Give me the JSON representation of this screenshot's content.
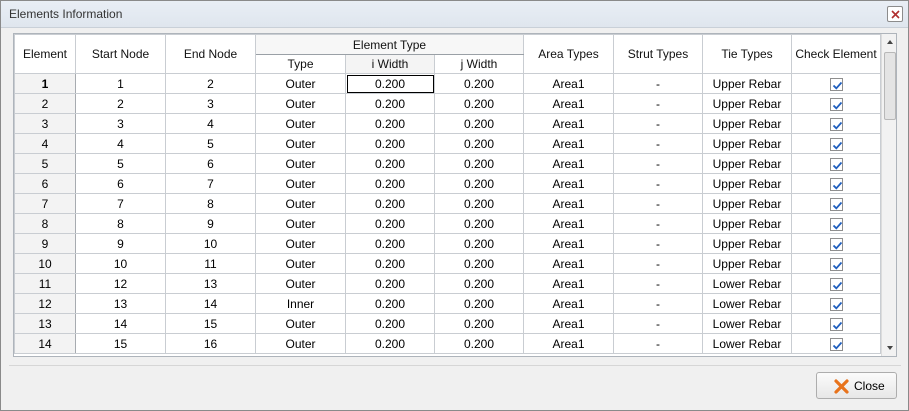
{
  "window": {
    "title": "Elements Information"
  },
  "table": {
    "headers": {
      "element": "Element",
      "start_node": "Start Node",
      "end_node": "End Node",
      "group": "Element Type",
      "type": "Type",
      "i_width": "i Width",
      "j_width": "j Width",
      "area_types": "Area Types",
      "strut_types": "Strut Types",
      "tie_types": "Tie Types",
      "check_element": "Check Element"
    },
    "rows": [
      {
        "element": "1",
        "start": "1",
        "end": "2",
        "type": "Outer",
        "iw": "0.200",
        "jw": "0.200",
        "area": "Area1",
        "strut": "-",
        "tie": "Upper Rebar",
        "checked": true
      },
      {
        "element": "2",
        "start": "2",
        "end": "3",
        "type": "Outer",
        "iw": "0.200",
        "jw": "0.200",
        "area": "Area1",
        "strut": "-",
        "tie": "Upper Rebar",
        "checked": true
      },
      {
        "element": "3",
        "start": "3",
        "end": "4",
        "type": "Outer",
        "iw": "0.200",
        "jw": "0.200",
        "area": "Area1",
        "strut": "-",
        "tie": "Upper Rebar",
        "checked": true
      },
      {
        "element": "4",
        "start": "4",
        "end": "5",
        "type": "Outer",
        "iw": "0.200",
        "jw": "0.200",
        "area": "Area1",
        "strut": "-",
        "tie": "Upper Rebar",
        "checked": true
      },
      {
        "element": "5",
        "start": "5",
        "end": "6",
        "type": "Outer",
        "iw": "0.200",
        "jw": "0.200",
        "area": "Area1",
        "strut": "-",
        "tie": "Upper Rebar",
        "checked": true
      },
      {
        "element": "6",
        "start": "6",
        "end": "7",
        "type": "Outer",
        "iw": "0.200",
        "jw": "0.200",
        "area": "Area1",
        "strut": "-",
        "tie": "Upper Rebar",
        "checked": true
      },
      {
        "element": "7",
        "start": "7",
        "end": "8",
        "type": "Outer",
        "iw": "0.200",
        "jw": "0.200",
        "area": "Area1",
        "strut": "-",
        "tie": "Upper Rebar",
        "checked": true
      },
      {
        "element": "8",
        "start": "8",
        "end": "9",
        "type": "Outer",
        "iw": "0.200",
        "jw": "0.200",
        "area": "Area1",
        "strut": "-",
        "tie": "Upper Rebar",
        "checked": true
      },
      {
        "element": "9",
        "start": "9",
        "end": "10",
        "type": "Outer",
        "iw": "0.200",
        "jw": "0.200",
        "area": "Area1",
        "strut": "-",
        "tie": "Upper Rebar",
        "checked": true
      },
      {
        "element": "10",
        "start": "10",
        "end": "11",
        "type": "Outer",
        "iw": "0.200",
        "jw": "0.200",
        "area": "Area1",
        "strut": "-",
        "tie": "Upper Rebar",
        "checked": true
      },
      {
        "element": "11",
        "start": "12",
        "end": "13",
        "type": "Outer",
        "iw": "0.200",
        "jw": "0.200",
        "area": "Area1",
        "strut": "-",
        "tie": "Lower Rebar",
        "checked": true
      },
      {
        "element": "12",
        "start": "13",
        "end": "14",
        "type": "Inner",
        "iw": "0.200",
        "jw": "0.200",
        "area": "Area1",
        "strut": "-",
        "tie": "Lower Rebar",
        "checked": true
      },
      {
        "element": "13",
        "start": "14",
        "end": "15",
        "type": "Outer",
        "iw": "0.200",
        "jw": "0.200",
        "area": "Area1",
        "strut": "-",
        "tie": "Lower Rebar",
        "checked": true
      },
      {
        "element": "14",
        "start": "15",
        "end": "16",
        "type": "Outer",
        "iw": "0.200",
        "jw": "0.200",
        "area": "Area1",
        "strut": "-",
        "tie": "Lower Rebar",
        "checked": true
      }
    ]
  },
  "buttons": {
    "close_label": "Close"
  },
  "icons": {
    "window_close": "close-icon",
    "checkbox_check": "check-icon",
    "close_button_icon": "x-icon",
    "scroll_up": "chevron-up-icon",
    "scroll_down": "chevron-down-icon"
  },
  "colors": {
    "check": "#1f5fbf",
    "close_icon": "#e8731c"
  }
}
